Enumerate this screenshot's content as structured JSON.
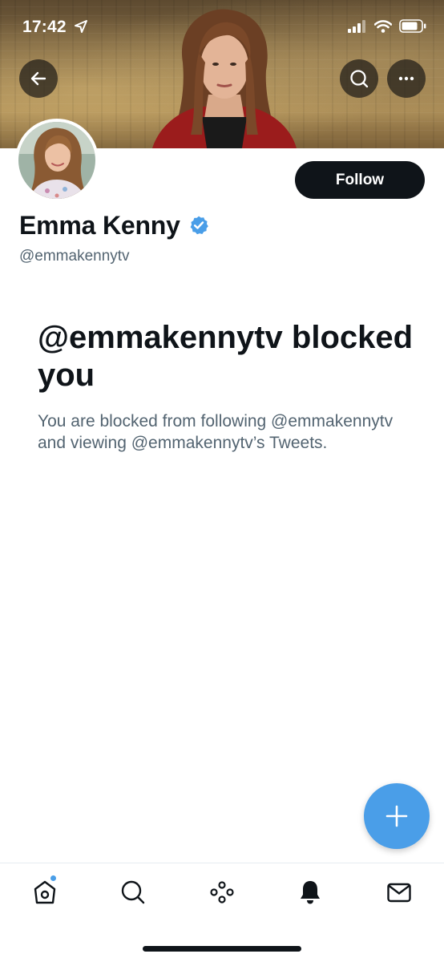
{
  "status_bar": {
    "time": "17:42",
    "icons": [
      "location-arrow-icon",
      "signal-icon",
      "wifi-icon",
      "battery-icon"
    ]
  },
  "header": {
    "back_icon": "arrow-left-icon",
    "search_icon": "search-icon",
    "more_icon": "more-horizontal-icon"
  },
  "profile": {
    "display_name": "Emma Kenny",
    "verified": true,
    "handle": "@emmakennytv",
    "follow_label": "Follow"
  },
  "blocked": {
    "title": "@emmakennytv blocked you",
    "description": "You are blocked from following @emmakennytv and viewing @emmakennytv’s Tweets."
  },
  "fab": {
    "icon": "plus-icon"
  },
  "bottom_nav": {
    "items": [
      "home-icon",
      "search-icon",
      "spaces-icon",
      "notifications-icon",
      "messages-icon"
    ],
    "home_has_new": true
  },
  "colors": {
    "accent": "#4a9ee8",
    "primary_text": "#0f1419",
    "secondary_text": "#536471",
    "follow_bg": "#0f1419"
  }
}
